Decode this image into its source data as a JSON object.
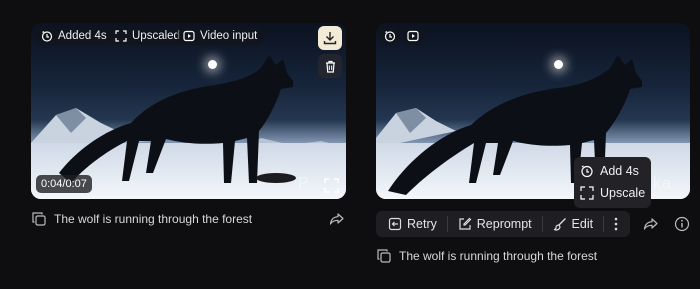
{
  "left_card": {
    "chips": {
      "added": "Added 4s",
      "upscaled": "Upscaled",
      "video_input": "Video input"
    },
    "time": "0:04/0:07",
    "watermark": "P",
    "caption": "The wolf is running through the forest"
  },
  "right_card": {
    "watermark": "ka",
    "caption": "The wolf is running through the forest",
    "toolbar": {
      "retry": "Retry",
      "reprompt": "Reprompt",
      "edit": "Edit"
    },
    "popup": {
      "add": "Add 4s",
      "upscale": "Upscale"
    }
  },
  "colors": {
    "background": "#0e0e10",
    "download_button": "#f3ead7",
    "toolbar": "#1f1f23"
  }
}
